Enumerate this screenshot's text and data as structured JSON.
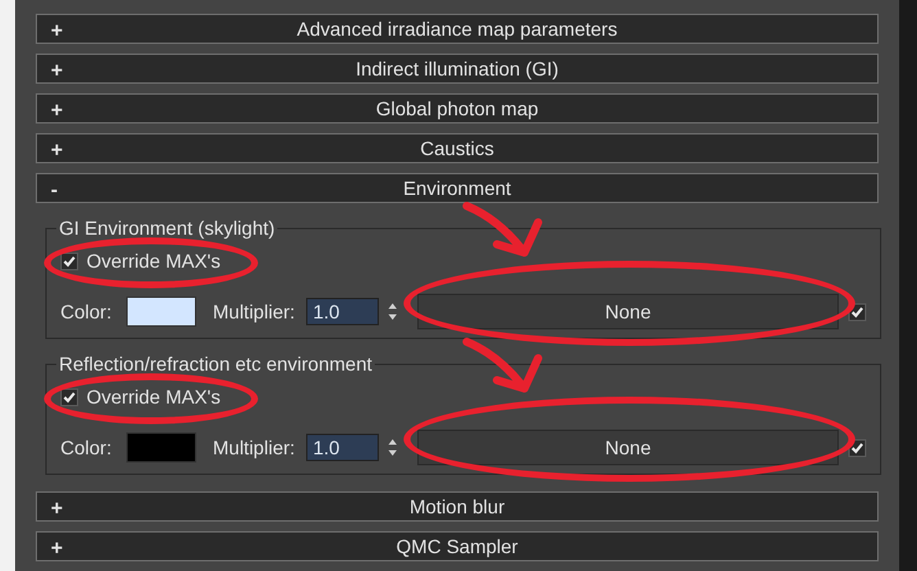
{
  "rollouts": [
    {
      "sign": "+",
      "title": "Advanced irradiance map parameters"
    },
    {
      "sign": "+",
      "title": "Indirect illumination (GI)"
    },
    {
      "sign": "+",
      "title": "Global photon map"
    },
    {
      "sign": "+",
      "title": "Caustics"
    },
    {
      "sign": "-",
      "title": "Environment",
      "groups": [
        {
          "title": "GI Environment (skylight)",
          "override": {
            "label": "Override MAX's",
            "checked": true,
            "circled": true
          },
          "color_label": "Color:",
          "color": "#d3e6ff",
          "multiplier_label": "Multiplier:",
          "multiplier": "1.0",
          "map": {
            "label": "None",
            "circled": true,
            "arrow": true
          },
          "map_enabled": true
        },
        {
          "title": "Reflection/refraction etc environment",
          "override": {
            "label": "Override MAX's",
            "checked": true,
            "circled": true
          },
          "color_label": "Color:",
          "color": "#000000",
          "multiplier_label": "Multiplier:",
          "multiplier": "1.0",
          "map": {
            "label": "None",
            "circled": true,
            "arrow": true
          },
          "map_enabled": true
        }
      ]
    },
    {
      "sign": "+",
      "title": "Motion blur"
    },
    {
      "sign": "+",
      "title": "QMC Sampler"
    }
  ]
}
